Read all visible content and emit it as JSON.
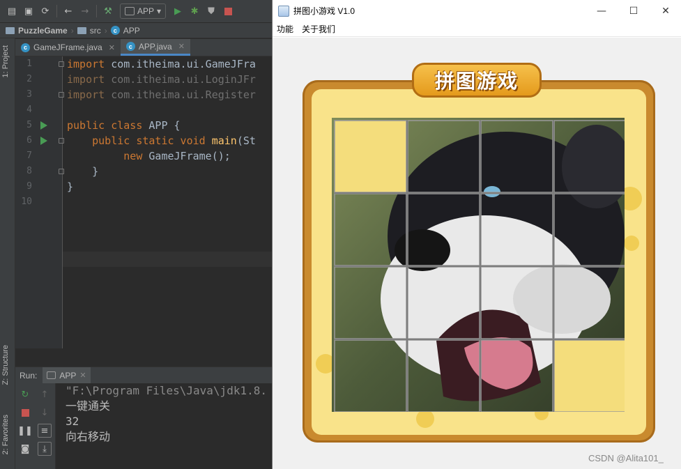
{
  "ide": {
    "toolbar": {
      "run_config": "APP"
    },
    "breadcrumbs": [
      "PuzzleGame",
      "src",
      "APP"
    ],
    "side_tabs": {
      "project": "1: Project",
      "structure": "Z: Structure",
      "favorites": "2: Favorites"
    },
    "editor_tabs": [
      {
        "label": "GameJFrame.java",
        "active": false
      },
      {
        "label": "APP.java",
        "active": true
      }
    ],
    "line_numbers": [
      "1",
      "2",
      "3",
      "4",
      "5",
      "6",
      "7",
      "8",
      "9",
      "10"
    ],
    "code": {
      "l1_kw": "import",
      "l1_rest": " com.itheima.ui.GameJFra",
      "l2_kw": "import",
      "l2_rest": " com.itheima.ui.LoginJFr",
      "l3_kw": "import",
      "l3_rest": " com.itheima.ui.Register",
      "l5_kw": "public class",
      "l5_rest": " APP {",
      "l6_kw": "public static void",
      "l6_fn": "main",
      "l6_rest": "(St",
      "l7_kw": "new",
      "l7_rest": " GameJFrame();",
      "l8": "}",
      "l9": "}"
    },
    "run": {
      "label": "Run:",
      "tab": "APP",
      "console": [
        "\"F:\\Program Files\\Java\\jdk1.8.",
        "一键通关",
        "32",
        "向右移动"
      ]
    }
  },
  "game": {
    "window_title": "拼图小游戏 V1.0",
    "menu": [
      "功能",
      "关于我们"
    ],
    "logo": "拼图游戏",
    "board": {
      "rows": 4,
      "cols": 4,
      "empty_tiles": [
        [
          0,
          0
        ],
        [
          3,
          3
        ]
      ]
    },
    "watermark": "CSDN @Alita101_"
  },
  "colors": {
    "ide_bg": "#2b2b2b",
    "keyword": "#cc7832",
    "function": "#ffc66d",
    "frame_orange": "#c98a2e",
    "board_yellow": "#f9e38a"
  }
}
